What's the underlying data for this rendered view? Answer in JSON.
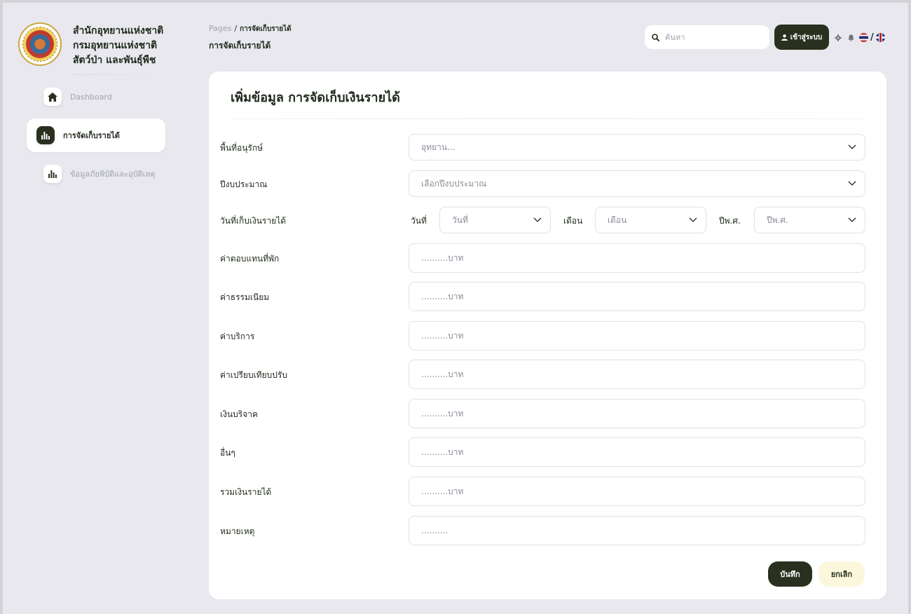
{
  "brand": {
    "line1": "สำนักอุทยานแห่งชาติ",
    "line2": "กรมอุทยานแห่งชาติ",
    "line3": "สัตว์ป่า และพันธุ์พืช",
    "logo_icon": "dnp-seal-logo"
  },
  "sidebar": {
    "items": [
      {
        "label": "Dashboard",
        "icon": "home-icon",
        "active": false
      },
      {
        "label": "การจัดเก็บรายได้",
        "icon": "bar-chart-icon",
        "active": true
      },
      {
        "label": "ข้อมูลภัยพิบัติและอุบัติเหตุ",
        "icon": "bar-chart-icon",
        "active": false
      }
    ]
  },
  "header": {
    "breadcrumb_root": "Pages",
    "breadcrumb_sep": "/",
    "breadcrumb_current": "การจัดเก็บรายได้",
    "page_title": "การจัดเก็บรายได้",
    "search_placeholder": "ค้นหา",
    "login_label": "เข้าสู่ระบบ",
    "lang_sep": "/"
  },
  "form": {
    "title": "เพิ่มข้อมูล การจัดเก็บเงินรายได้",
    "area_label": "พื้นที่อนุรักษ์",
    "area_placeholder": "อุทยาน...",
    "budget_year_label": "ปีงบประมาณ",
    "budget_year_placeholder": "เลือกปีงบประมาณ",
    "date_label": "วันที่เก็บเงินรายได้",
    "day_label": "วันที่",
    "day_placeholder": "วันที่",
    "month_label": "เดือน",
    "month_placeholder": "เดือน",
    "year_label": "ปีพ.ศ.",
    "year_placeholder": "ปีพ.ศ.",
    "amount_fields": [
      {
        "label": "ค่าตอบแทนที่พัก",
        "placeholder": "..........บาท"
      },
      {
        "label": "ค่าธรรมเนียม",
        "placeholder": "..........บาท"
      },
      {
        "label": "ค่าบริการ",
        "placeholder": "..........บาท"
      },
      {
        "label": "ค่าเปรียบเทียบปรับ",
        "placeholder": "..........บาท"
      },
      {
        "label": "เงินบริจาค",
        "placeholder": "..........บาท"
      },
      {
        "label": "อื่นๆ",
        "placeholder": "..........บาท"
      },
      {
        "label": "รวมเงินรายได้",
        "placeholder": "..........บาท"
      }
    ],
    "note_label": "หมายเหตุ",
    "note_placeholder": "..........",
    "save_label": "บันทึก",
    "cancel_label": "ยกเลิก"
  },
  "colors": {
    "accent_dark": "#2a3020",
    "cancel_bg": "#fbf7dc",
    "page_bg": "#e8e8ee"
  }
}
